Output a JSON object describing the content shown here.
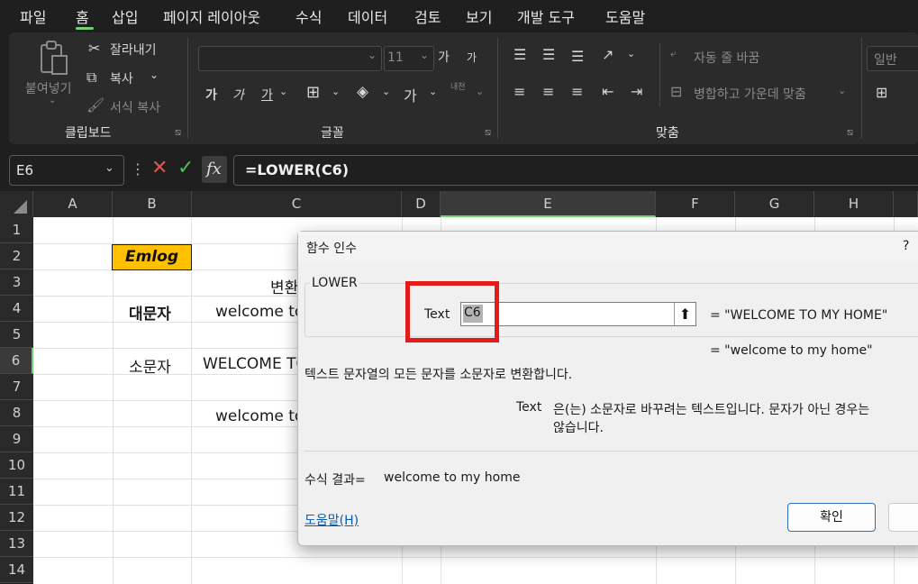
{
  "menu": {
    "items": [
      "파일",
      "홈",
      "삽입",
      "페이지 레이아웃",
      "수식",
      "데이터",
      "검토",
      "보기",
      "개발 도구",
      "도움말"
    ],
    "active": "홈"
  },
  "ribbon": {
    "clipboard": {
      "paste": "붙여넣기",
      "cut": "잘라내기",
      "copy": "복사",
      "format_painter": "서식 복사",
      "label": "클립보드"
    },
    "font": {
      "font_size": "11",
      "grow": "가",
      "shrink": "가",
      "bold": "가",
      "italic": "가",
      "underline": "가",
      "font_color": "가",
      "phonetic": "내천",
      "label": "글꼴"
    },
    "alignment": {
      "wrap_text": "자동 줄 바꿈",
      "merge_center": "병합하고 가운데 맞춤",
      "label": "맞춤"
    },
    "number": {
      "format": "일반"
    }
  },
  "formula_bar": {
    "name_box": "E6",
    "fx": "fx",
    "formula": "=LOWER(C6)"
  },
  "sheet": {
    "columns": [
      "A",
      "B",
      "C",
      "D",
      "E",
      "F",
      "G",
      "H"
    ],
    "rows": [
      "1",
      "2",
      "3",
      "4",
      "5",
      "6",
      "7",
      "8",
      "9",
      "10",
      "11",
      "12",
      "13",
      "14"
    ],
    "cells": {
      "b2": "Emlog",
      "c3": "변환",
      "b4": "대문자",
      "c4": "welcome to",
      "b6": "소문자",
      "c6": "WELCOME TO",
      "c8": "welcome to"
    }
  },
  "dialog": {
    "title": "함수 인수",
    "help_mark": "?",
    "function_name": "LOWER",
    "arg_label": "Text",
    "arg_value": "C6",
    "arg_result": "= \"WELCOME TO MY HOME\"",
    "formula_result": "= \"welcome to my home\"",
    "description": "텍스트 문자열의 모든 문자를 소문자로 변환합니다.",
    "arg_desc_label": "Text",
    "arg_desc_line1": "은(는) 소문자로 바꾸려는 텍스트입니다. 문자가 아닌 경우는",
    "arg_desc_line2": "않습니다.",
    "result_label": "수식 결과=",
    "result_value": "welcome to my home",
    "help_link": "도움말(H)",
    "ok_label": "확인"
  },
  "colors": {
    "accent_green": "#6fd46f",
    "highlight_red": "#e41b1b",
    "label_fill": "#ffc000"
  }
}
